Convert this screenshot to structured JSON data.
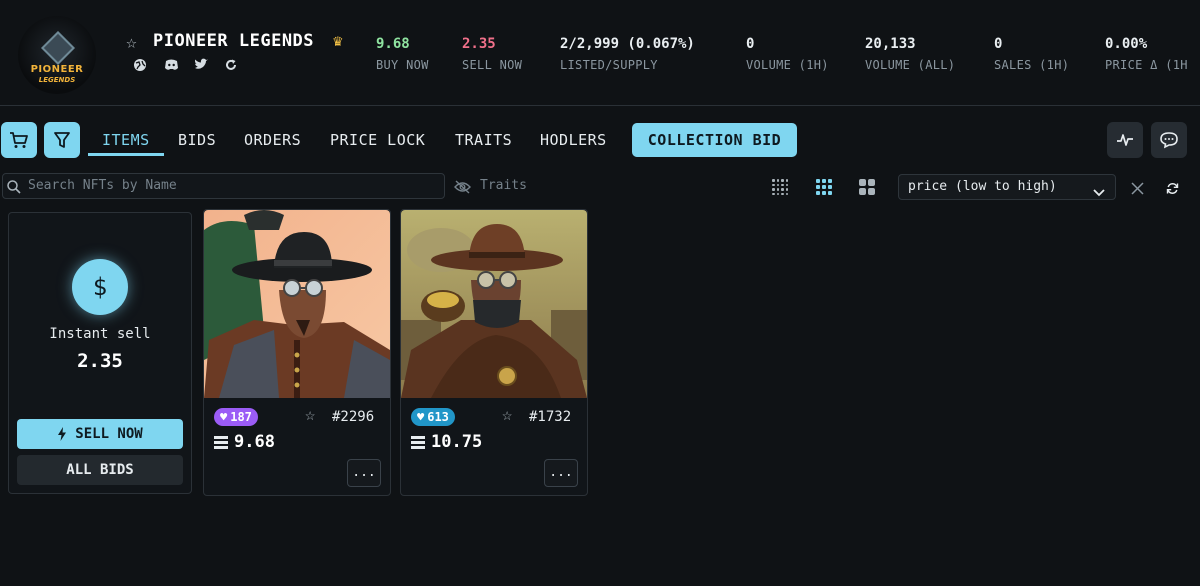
{
  "collection": {
    "name": "PIONEER LEGENDS",
    "logo_line1": "PIONEER",
    "logo_line2": "LEGENDS"
  },
  "stats": [
    {
      "value": "9.68",
      "label": "BUY NOW",
      "color": "#8fe3a0"
    },
    {
      "value": "2.35",
      "label": "SELL NOW",
      "color": "#f0708a"
    },
    {
      "value": "2/2,999 (0.067%)",
      "label": "LISTED/SUPPLY",
      "color": "#e9eef1"
    },
    {
      "value": "0",
      "label": "VOLUME (1H)",
      "color": "#e9eef1"
    },
    {
      "value": "20,133",
      "label": "VOLUME (ALL)",
      "color": "#e9eef1"
    },
    {
      "value": "0",
      "label": "SALES (1H)",
      "color": "#e9eef1"
    },
    {
      "value": "0.00%",
      "label": "PRICE Δ (1H",
      "color": "#e9eef1"
    }
  ],
  "tabs": [
    {
      "label": "ITEMS",
      "active": true
    },
    {
      "label": "BIDS"
    },
    {
      "label": "ORDERS"
    },
    {
      "label": "PRICE LOCK"
    },
    {
      "label": "TRAITS"
    },
    {
      "label": "HODLERS"
    }
  ],
  "collection_bid_label": "COLLECTION BID",
  "search": {
    "placeholder": "Search NFTs by Name"
  },
  "traits_label": "Traits",
  "sort": {
    "selected": "price (low to high)"
  },
  "sell_card": {
    "icon": "$",
    "title": "Instant sell",
    "value": "2.35",
    "sell_label": "SELL NOW",
    "bids_label": "ALL BIDS"
  },
  "nfts": [
    {
      "rank": "187",
      "id": "#2296",
      "price": "9.68",
      "badge_color": "#9b5cf6",
      "more": "..."
    },
    {
      "rank": "613",
      "id": "#1732",
      "price": "10.75",
      "badge_color": "#2196c8",
      "more": "..."
    }
  ],
  "colors": {
    "accent": "#7fd6f0",
    "background": "#0f1215"
  }
}
